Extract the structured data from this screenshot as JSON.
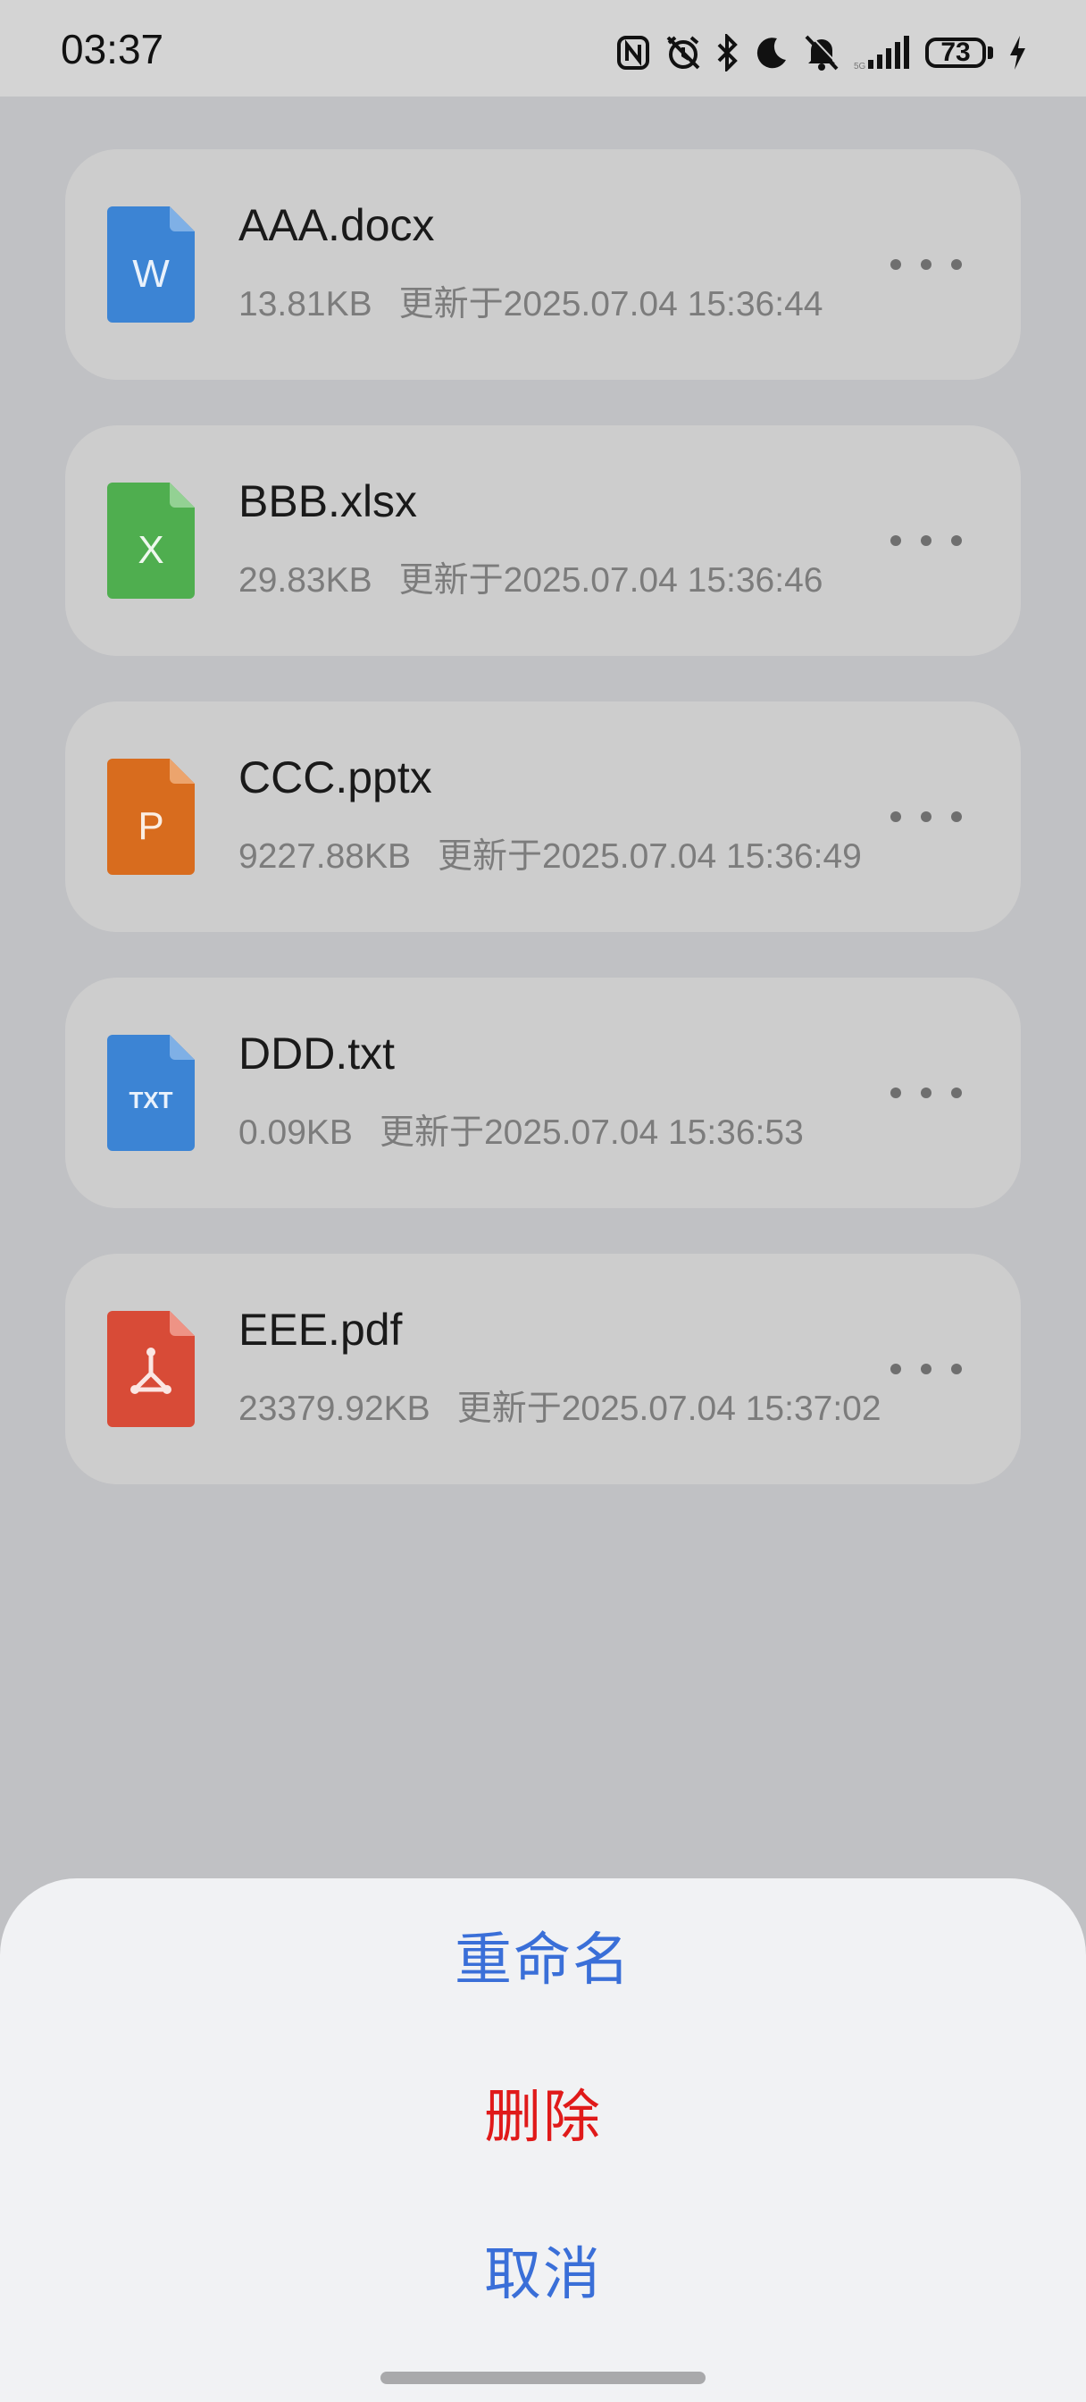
{
  "status_bar": {
    "time": "03:37",
    "icons": [
      "nfc-icon",
      "alarm-icon",
      "bluetooth-icon",
      "do-not-disturb-moon-icon",
      "silent-bell-icon",
      "signal-icon",
      "battery-icon",
      "charging-icon"
    ],
    "battery_level": "73"
  },
  "files": [
    {
      "name": "AAA.docx",
      "size": "13.81KB",
      "updated": "更新于2025.07.04 15:36:44",
      "type": "word",
      "icon_letter": "W",
      "color": "#3d86d6"
    },
    {
      "name": "BBB.xlsx",
      "size": "29.83KB",
      "updated": "更新于2025.07.04 15:36:46",
      "type": "excel",
      "icon_letter": "X",
      "color": "#4faf4f"
    },
    {
      "name": "CCC.pptx",
      "size": "9227.88KB",
      "updated": "更新于2025.07.04 15:36:49",
      "type": "powerpoint",
      "icon_letter": "P",
      "color": "#d86e1f"
    },
    {
      "name": "DDD.txt",
      "size": "0.09KB",
      "updated": "更新于2025.07.04 15:36:53",
      "type": "text",
      "icon_letter": "TXT",
      "color": "#3d86d6"
    },
    {
      "name": "EEE.pdf",
      "size": "23379.92KB",
      "updated": "更新于2025.07.04 15:37:02",
      "type": "pdf",
      "icon_letter": "",
      "color": "#d84b37"
    }
  ],
  "action_sheet": {
    "rename_label": "重命名",
    "delete_label": "删除",
    "cancel_label": "取消",
    "rename_color": "#3a6fd8",
    "delete_color": "#e01a1a",
    "cancel_color": "#3a6fd8"
  }
}
